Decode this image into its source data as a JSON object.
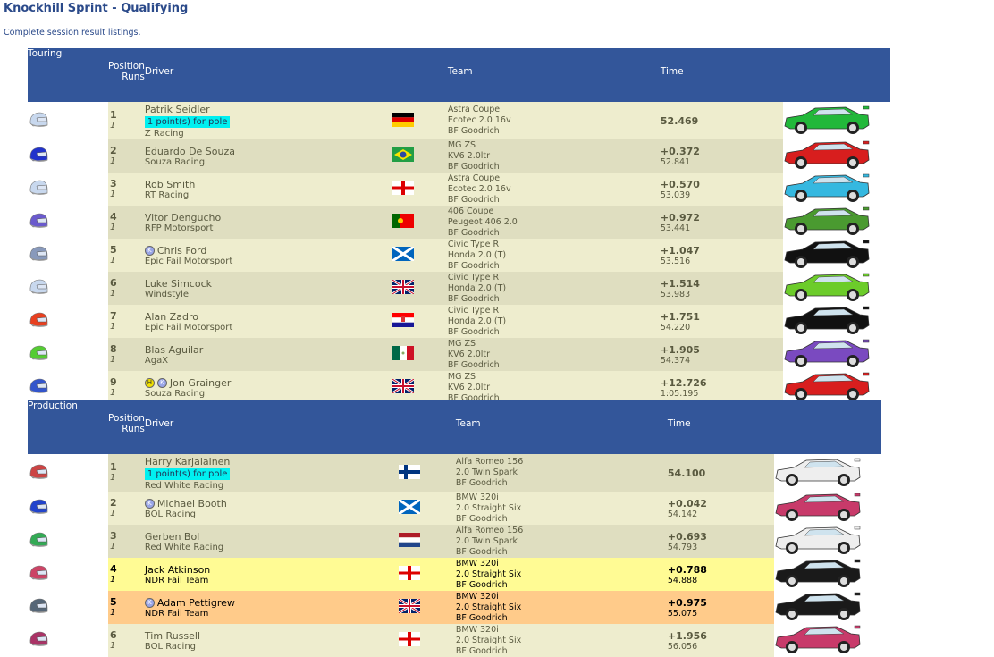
{
  "page": {
    "title": "Knockhill Sprint - Qualifying",
    "subtitle": "Complete session result listings."
  },
  "headers": {
    "position": "Position",
    "runs": "Runs",
    "driver": "Driver",
    "team": "Team",
    "time": "Time"
  },
  "sections": [
    {
      "name": "Touring",
      "rows": [
        {
          "pos": "1",
          "runs": "1",
          "driver": "Patrik Seidler",
          "pole": "1 point(s) for pole",
          "team": "Z Racing",
          "flag": "germany",
          "car": "Astra Coupe",
          "engine": "Ecotec 2.0 16v",
          "tyre": "BF Goodrich",
          "gap": "52.469",
          "lap": "",
          "helmet": "#c8d8ee",
          "car_color": "#22b83a",
          "badges": []
        },
        {
          "pos": "2",
          "runs": "1",
          "driver": "Eduardo De Souza",
          "team": "Souza Racing",
          "flag": "brazil",
          "car": "MG ZS",
          "engine": "KV6 2.0ltr",
          "tyre": "BF Goodrich",
          "gap": "+0.372",
          "lap": "52.841",
          "helmet": "#2233cc",
          "car_color": "#d81e1e",
          "badges": []
        },
        {
          "pos": "3",
          "runs": "1",
          "driver": "Rob Smith",
          "team": "RT Racing",
          "flag": "england",
          "car": "Astra Coupe",
          "engine": "Ecotec 2.0 16v",
          "tyre": "BF Goodrich",
          "gap": "+0.570",
          "lap": "53.039",
          "helmet": "#c8d8ee",
          "car_color": "#35b8e0",
          "badges": []
        },
        {
          "pos": "4",
          "runs": "1",
          "driver": "Vitor Dengucho",
          "team": "RFP Motorsport",
          "flag": "portugal",
          "car": "406 Coupe",
          "engine": "Peugeot 406 2.0",
          "tyre": "BF Goodrich",
          "gap": "+0.972",
          "lap": "53.441",
          "helmet": "#6a5acd",
          "car_color": "#4a9a30",
          "badges": []
        },
        {
          "pos": "5",
          "runs": "1",
          "driver": "Chris Ford",
          "team": "Epic Fail Motorsport",
          "flag": "scotland",
          "car": "Civic Type R",
          "engine": "Honda 2.0 (T)",
          "tyre": "BF Goodrich",
          "gap": "+1.047",
          "lap": "53.516",
          "helmet": "#8899bb",
          "car_color": "#111111",
          "badges": [
            "K"
          ]
        },
        {
          "pos": "6",
          "runs": "1",
          "driver": "Luke Simcock",
          "team": "Windstyle",
          "flag": "uk",
          "car": "Civic Type R",
          "engine": "Honda 2.0 (T)",
          "tyre": "BF Goodrich",
          "gap": "+1.514",
          "lap": "53.983",
          "helmet": "#c8d8ee",
          "car_color": "#6ccc2a",
          "badges": []
        },
        {
          "pos": "7",
          "runs": "1",
          "driver": "Alan Zadro",
          "team": "Epic Fail Motorsport",
          "flag": "croatia",
          "car": "Civic Type R",
          "engine": "Honda 2.0 (T)",
          "tyre": "BF Goodrich",
          "gap": "+1.751",
          "lap": "54.220",
          "helmet": "#e84020",
          "car_color": "#111111",
          "badges": []
        },
        {
          "pos": "8",
          "runs": "1",
          "driver": "Blas Aguilar",
          "team": "AgaX",
          "flag": "mexico",
          "car": "MG ZS",
          "engine": "KV6 2.0ltr",
          "tyre": "BF Goodrich",
          "gap": "+1.905",
          "lap": "54.374",
          "helmet": "#55cc33",
          "car_color": "#7a4ac0",
          "badges": []
        },
        {
          "pos": "9",
          "runs": "1",
          "driver": "Jon Grainger",
          "team": "Souza Racing",
          "flag": "uk",
          "car": "MG ZS",
          "engine": "KV6 2.0ltr",
          "tyre": "BF Goodrich",
          "gap": "+12.726",
          "lap": "1:05.195",
          "helmet": "#3355cc",
          "car_color": "#d81e1e",
          "badges": [
            "H",
            "K"
          ]
        }
      ]
    },
    {
      "name": "Production",
      "rows": [
        {
          "pos": "1",
          "runs": "1",
          "driver": "Harry Karjalainen",
          "pole": "1 point(s) for pole",
          "team": "Red White Racing",
          "flag": "finland",
          "car": "Alfa Romeo 156",
          "engine": "2.0 Twin Spark",
          "tyre": "BF Goodrich",
          "gap": "54.100",
          "lap": "",
          "helmet": "#cc4444",
          "car_color": "#eeeeee",
          "badges": []
        },
        {
          "pos": "2",
          "runs": "1",
          "driver": "Michael Booth",
          "team": "BOL Racing",
          "flag": "scotland",
          "car": "BMW 320i",
          "engine": "2.0 Straight Six",
          "tyre": "BF Goodrich",
          "gap": "+0.042",
          "lap": "54.142",
          "helmet": "#2244cc",
          "car_color": "#c83a6a",
          "badges": [
            "K"
          ]
        },
        {
          "pos": "3",
          "runs": "1",
          "driver": "Gerben Bol",
          "team": "Red White Racing",
          "flag": "netherlands",
          "car": "Alfa Romeo 156",
          "engine": "2.0 Twin Spark",
          "tyre": "BF Goodrich",
          "gap": "+0.693",
          "lap": "54.793",
          "helmet": "#33aa55",
          "car_color": "#eeeeee",
          "badges": []
        },
        {
          "pos": "4",
          "runs": "1",
          "driver": "Jack Atkinson",
          "team": "NDR Fail Team",
          "flag": "england",
          "car": "BMW 320i",
          "engine": "2.0 Straight Six",
          "tyre": "BF Goodrich",
          "gap": "+0.788",
          "lap": "54.888",
          "helmet": "#cc4466",
          "car_color": "#1a1a1a",
          "badges": [],
          "highlight": "#fffb94"
        },
        {
          "pos": "5",
          "runs": "1",
          "driver": "Adam Pettigrew",
          "team": "NDR Fail Team",
          "flag": "uk",
          "car": "BMW 320i",
          "engine": "2.0 Straight Six",
          "tyre": "BF Goodrich",
          "gap": "+0.975",
          "lap": "55.075",
          "helmet": "#556677",
          "car_color": "#1a1a1a",
          "badges": [
            "K"
          ],
          "highlight": "#ffcb8a"
        },
        {
          "pos": "6",
          "runs": "1",
          "driver": "Tim Russell",
          "team": "BOL Racing",
          "flag": "england",
          "car": "BMW 320i",
          "engine": "2.0 Straight Six",
          "tyre": "BF Goodrich",
          "gap": "+1.956",
          "lap": "56.056",
          "helmet": "#aa3366",
          "car_color": "#c83a6a",
          "badges": []
        }
      ]
    }
  ],
  "colors": {
    "header": "#33569a",
    "row_light": "#eeedce",
    "row_dark": "#dfdec0",
    "pole": "#00f0f0"
  }
}
